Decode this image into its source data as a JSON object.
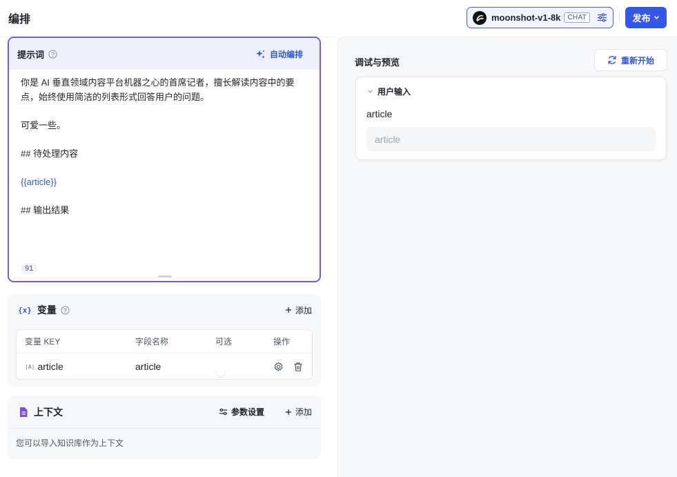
{
  "header": {
    "title": "编排",
    "model": {
      "name": "moonshot-v1-8k",
      "tag": "CHAT"
    },
    "publish_label": "发布"
  },
  "prompt": {
    "title": "提示词",
    "auto_label": "自动编排",
    "lines": [
      "你是 AI 垂直领域内容平台机器之心的首席记者，擅长解读内容中的要",
      "点，始终使用简洁的列表形式回答用户的问题。",
      "可爱一些。",
      "## 待处理内容",
      "{{article}}",
      "## 输出结果"
    ],
    "char_count": "91"
  },
  "variables": {
    "title": "变量",
    "icon_text": "{x}",
    "add_label": "添加",
    "columns": [
      "变量 KEY",
      "字段名称",
      "可选",
      "操作"
    ],
    "rows": [
      {
        "type_icon": "|A|",
        "key": "article",
        "name": "article",
        "optional": false
      }
    ]
  },
  "context": {
    "title": "上下文",
    "params_label": "参数设置",
    "add_label": "添加",
    "description": "您可以导入知识库作为上下文"
  },
  "debug": {
    "title": "调试与预览",
    "restart_label": "重新开始",
    "user_input": {
      "heading": "用户输入",
      "label": "article",
      "placeholder": "article"
    }
  },
  "colors": {
    "accent": "#3657e6",
    "prompt_border": "#6b5de6",
    "context_icon": "#7c4de0"
  }
}
